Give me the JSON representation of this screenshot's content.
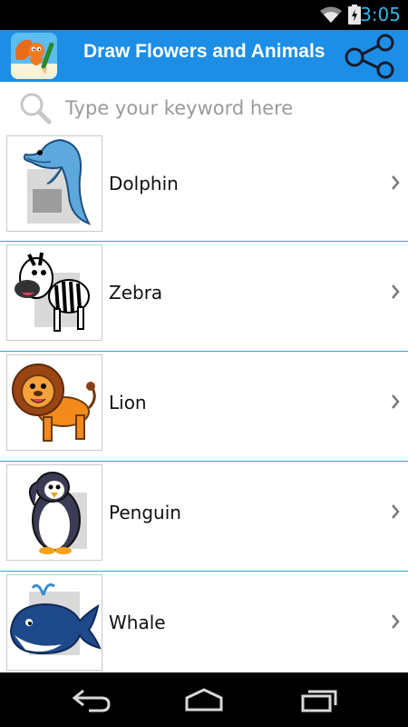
{
  "status_bar": {
    "time": "3:05",
    "icons": [
      "wifi-icon",
      "battery-charging-icon"
    ]
  },
  "action_bar": {
    "title": "Draw Flowers and Animals",
    "app_icon": "squirrel-drawing-icon",
    "share_icon": "share-icon"
  },
  "search": {
    "placeholder": "Type your keyword here",
    "value": "",
    "icon": "magnifier-icon"
  },
  "items": [
    {
      "label": "Dolphin",
      "thumbnail": "dolphin-image"
    },
    {
      "label": "Zebra",
      "thumbnail": "zebra-image"
    },
    {
      "label": "Lion",
      "thumbnail": "lion-image"
    },
    {
      "label": "Penguin",
      "thumbnail": "penguin-image"
    },
    {
      "label": "Whale",
      "thumbnail": "whale-image"
    }
  ],
  "nav_bar": {
    "icons": [
      "back-icon",
      "home-icon",
      "recents-icon"
    ]
  },
  "colors": {
    "action_bar": "#1c8ee6",
    "divider": "#36a6de",
    "status_time": "#33b5e5"
  }
}
